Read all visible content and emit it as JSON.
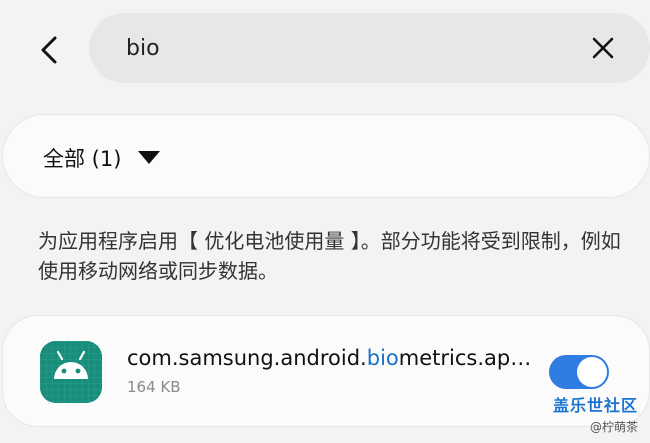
{
  "search": {
    "value": "bio",
    "back_icon": "chevron-left-icon",
    "clear_icon": "close-icon"
  },
  "filter": {
    "label": "全部 (1)",
    "dropdown_icon": "caret-down-icon"
  },
  "description": "为应用程序启用【 优化电池使用量 】。部分功能将受到限制，例如使用移动网络或同步数据。",
  "apps": [
    {
      "name_prefix": "com.samsung.android.",
      "name_match": "bio",
      "name_suffix": "metrics.ap…",
      "size": "164 KB",
      "icon": "android-icon",
      "enabled": true
    }
  ],
  "watermark": {
    "brand": "盖乐世社区",
    "user": "@柠萌茶"
  },
  "colors": {
    "background": "#f3f3f3",
    "card": "#fbfbfb",
    "search_pill": "#e7e7e7",
    "highlight": "#1b72c9",
    "toggle_on": "#2f7de1",
    "app_icon_bg": "#1a8c7a"
  }
}
